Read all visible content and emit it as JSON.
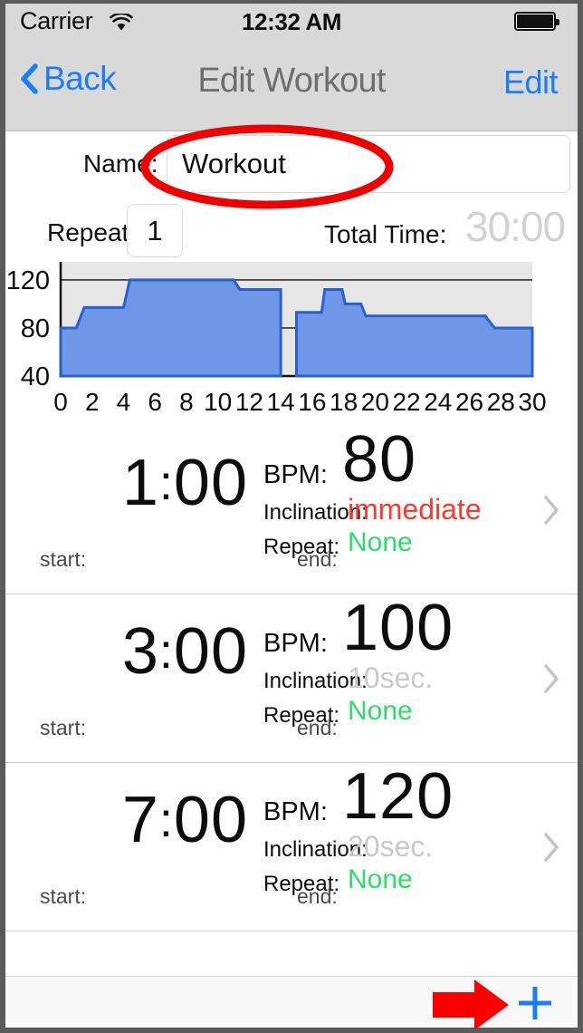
{
  "status_bar": {
    "carrier": "Carrier",
    "wifi_icon": "wifi-icon",
    "time": "12:32 AM",
    "battery_icon": "battery-full-icon"
  },
  "nav_bar": {
    "back_label": "Back",
    "back_icon": "chevron-left-icon",
    "title": "Edit Workout",
    "edit_label": "Edit"
  },
  "form": {
    "name_label": "Name:",
    "name_value": "Workout",
    "name_placeholder": "Workout",
    "repeat_label": "Repeat:",
    "repeat_value": "1",
    "total_time_label": "Total Time:",
    "total_time_value": "30:00"
  },
  "annotations": {
    "ellipse_color": "#ee0000",
    "arrow_color": "#fb0000",
    "arrow_icon": "right-arrow-annotation"
  },
  "chart_data": {
    "type": "area",
    "title": "",
    "xlabel": "",
    "ylabel": "",
    "xlim": [
      0,
      30
    ],
    "ylim": [
      40,
      135
    ],
    "xticks": [
      "0",
      "2",
      "4",
      "6",
      "8",
      "10",
      "12",
      "14",
      "16",
      "18",
      "20",
      "22",
      "24",
      "26",
      "28",
      "30"
    ],
    "xtick_values": [
      0,
      2,
      4,
      6,
      8,
      10,
      12,
      14,
      16,
      18,
      20,
      22,
      24,
      26,
      28,
      30
    ],
    "yticks": [
      "120",
      "80",
      "40"
    ],
    "ytick_values": [
      120,
      80,
      40
    ],
    "gridlines": [
      120,
      80
    ],
    "grid": true,
    "legend": false,
    "plot_bg": "#e6e6e6",
    "series": [
      {
        "name": "BPM",
        "fill_color": "#6f97e8",
        "line_color": "#2b5fd0",
        "step": true,
        "segments": [
          {
            "name": "segment-1",
            "x_start": 0,
            "x_end": 14,
            "points": [
              {
                "x": 0,
                "y": 80
              },
              {
                "x": 1,
                "y": 80
              },
              {
                "x": 1.5,
                "y": 97
              },
              {
                "x": 4,
                "y": 97
              },
              {
                "x": 4.4,
                "y": 120
              },
              {
                "x": 11,
                "y": 120
              },
              {
                "x": 11.4,
                "y": 112
              },
              {
                "x": 14,
                "y": 112
              }
            ]
          },
          {
            "name": "segment-2",
            "x_start": 15,
            "x_end": 30,
            "points": [
              {
                "x": 15,
                "y": 93
              },
              {
                "x": 16.6,
                "y": 93
              },
              {
                "x": 16.8,
                "y": 112
              },
              {
                "x": 17.9,
                "y": 112
              },
              {
                "x": 18.1,
                "y": 100
              },
              {
                "x": 19.1,
                "y": 100
              },
              {
                "x": 19.4,
                "y": 90
              },
              {
                "x": 27,
                "y": 90
              },
              {
                "x": 27.6,
                "y": 80
              },
              {
                "x": 30,
                "y": 80
              }
            ]
          }
        ]
      }
    ]
  },
  "intervals": [
    {
      "duration_minutes": "1",
      "duration_seconds": "00",
      "bpm_label": "BPM:",
      "bpm_value": "80",
      "inclination_label": "Inclination:",
      "inclination_value": "immediate",
      "inclination_style": "immediate",
      "repeat_label": "Repeat:",
      "repeat_value": "None",
      "start_label": "start:",
      "start_value": "",
      "end_label": "end:",
      "end_value": "",
      "disclosure_icon": "chevron-right-icon"
    },
    {
      "duration_minutes": "3",
      "duration_seconds": "00",
      "bpm_label": "BPM:",
      "bpm_value": "100",
      "inclination_label": "Inclination:",
      "inclination_value": "10sec.",
      "inclination_style": "dim",
      "repeat_label": "Repeat:",
      "repeat_value": "None",
      "start_label": "start:",
      "start_value": "",
      "end_label": "end:",
      "end_value": "",
      "disclosure_icon": "chevron-right-icon"
    },
    {
      "duration_minutes": "7",
      "duration_seconds": "00",
      "bpm_label": "BPM:",
      "bpm_value": "120",
      "inclination_label": "Inclination:",
      "inclination_value": "20sec.",
      "inclination_style": "dim",
      "repeat_label": "Repeat:",
      "repeat_value": "None",
      "start_label": "start:",
      "start_value": "",
      "end_label": "end:",
      "end_value": "",
      "disclosure_icon": "chevron-right-icon"
    }
  ],
  "toolbar": {
    "add_icon": "plus-icon",
    "add_color": "#1a7cff"
  }
}
